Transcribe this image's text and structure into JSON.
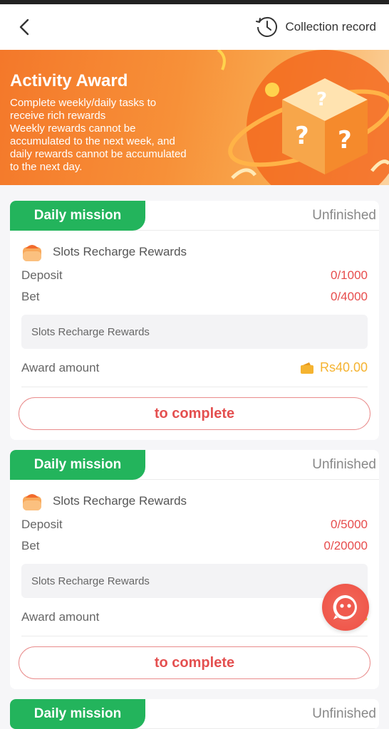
{
  "header": {
    "record_label": "Collection record"
  },
  "banner": {
    "title": "Activity Award",
    "description_lines": [
      "Complete weekly/daily tasks to",
      "receive rich rewards",
      "Weekly rewards cannot be",
      "accumulated to the next week, and",
      "daily rewards cannot be accumulated",
      "to the next day."
    ]
  },
  "missions": [
    {
      "tab": "Daily mission",
      "status": "Unfinished",
      "task_name": "Slots Recharge Rewards",
      "deposit_label": "Deposit",
      "deposit_progress": "0/1000",
      "bet_label": "Bet",
      "bet_progress": "0/4000",
      "description": "Slots Recharge Rewards",
      "award_label": "Award amount",
      "award_value": "Rs40.00",
      "button": "to complete"
    },
    {
      "tab": "Daily mission",
      "status": "Unfinished",
      "task_name": "Slots Recharge Rewards",
      "deposit_label": "Deposit",
      "deposit_progress": "0/5000",
      "bet_label": "Bet",
      "bet_progress": "0/20000",
      "description": "Slots Recharge Rewards",
      "award_label": "Award amount",
      "award_value": "Rs",
      "button": "to complete"
    },
    {
      "tab": "Daily mission",
      "status": "Unfinished"
    }
  ],
  "icons": {
    "back": "chevron-left-icon",
    "record": "history-clock-icon",
    "task": "orange-wallet-icon",
    "award": "yellow-wallet-icon",
    "chat": "chat-bubble-icon"
  },
  "colors": {
    "accent_green": "#23b45c",
    "progress_red": "#e74c4c",
    "award_gold": "#f5b330",
    "banner_orange": "#f4782a"
  }
}
